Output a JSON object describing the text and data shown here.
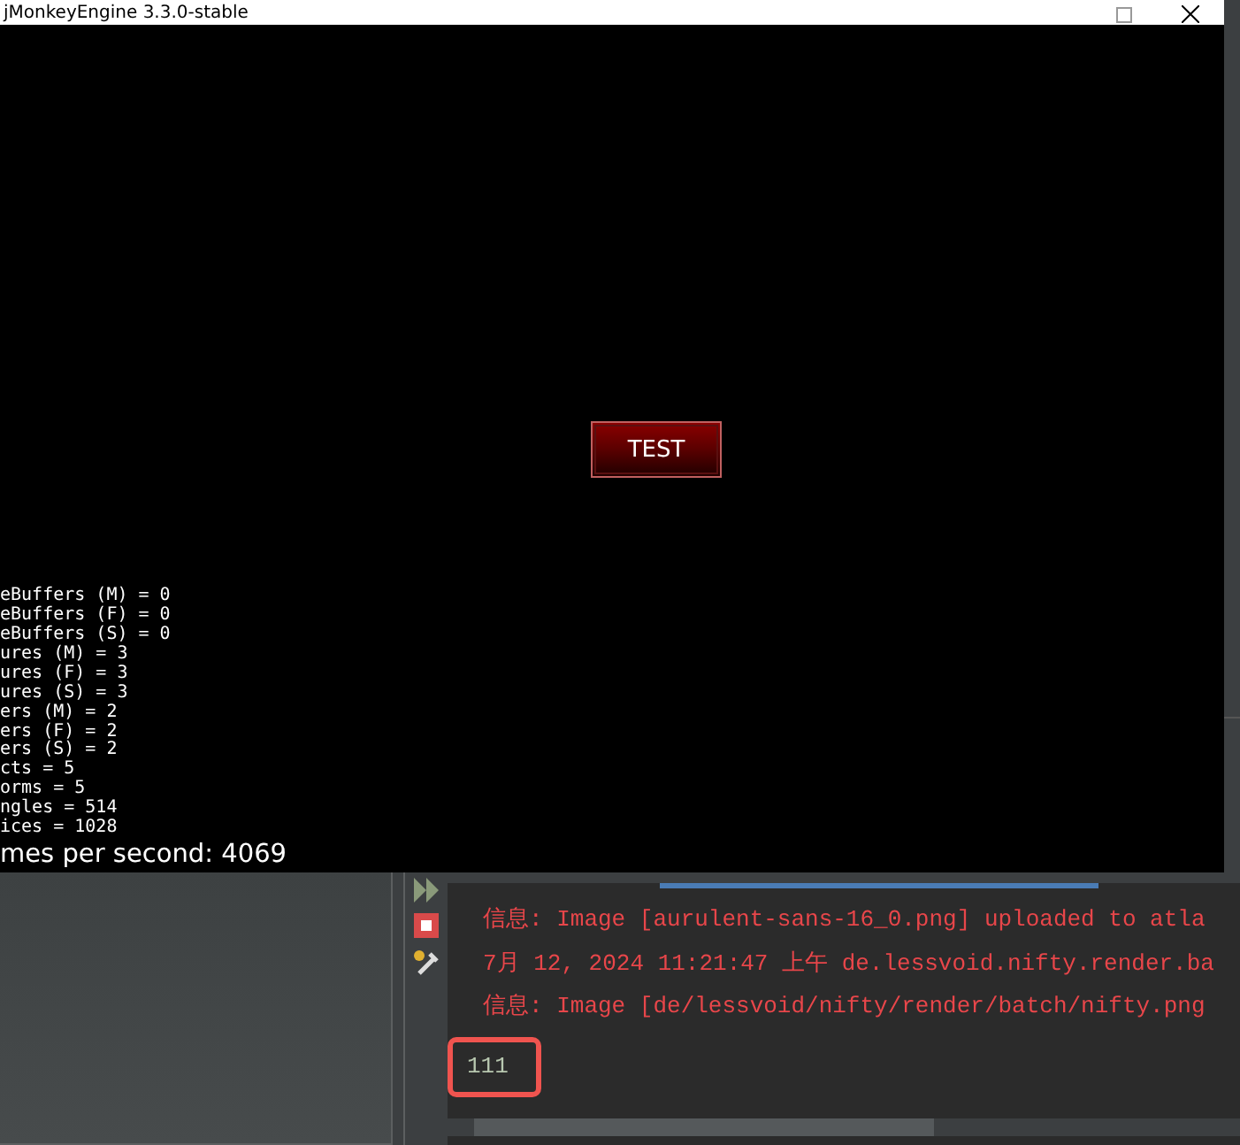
{
  "game_window": {
    "title": "jMonkeyEngine 3.3.0-stable",
    "button": "TEST",
    "stats": [
      "eBuffers (M) = 0",
      "eBuffers (F) = 0",
      "eBuffers (S) = 0",
      "ures (M) = 3",
      "ures (F) = 3",
      "ures (S) = 3",
      "ers (M) = 2",
      "ers (F) = 2",
      "ers (S) = 2",
      "cts = 5",
      "orms = 5",
      "ngles = 514",
      "ices = 1028"
    ],
    "fps": "mes per second: 4069"
  },
  "output": {
    "lines": [
      {
        "kind": "log",
        "text": "信息: Image [aurulent-sans-16_0.png] uploaded to atla",
        "highlighted": false
      },
      {
        "kind": "log",
        "text": "7月 12, 2024 11:21:47 上午 de.lessvoid.nifty.render.ba",
        "highlighted": false
      },
      {
        "kind": "log",
        "text": "信息: Image [de/lessvoid/nifty/render/batch/nifty.png",
        "highlighted": false
      },
      {
        "kind": "program",
        "text": "111",
        "highlighted": true
      }
    ]
  }
}
